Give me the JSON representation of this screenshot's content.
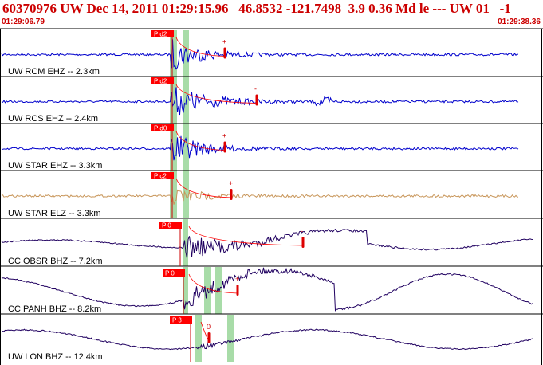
{
  "header": {
    "title": "60370976 UW Dec 14, 2011 01:29:15.96   46.8532 -121.7498  3.9 0.36 Md le --- UW 01   -1",
    "start_time": "01:29:06.79",
    "end_time": "01:29:38.36"
  },
  "colors": {
    "header_text": "#cc0000",
    "pick_box": "#ff0000",
    "pick_window": "#a8dca8",
    "trace_blue": "#0000cc",
    "trace_tan": "#c8965a",
    "trace_navy": "#200060",
    "coda_curve": "#ff0000"
  },
  "traces": [
    {
      "label": "UW RCM EHZ -- 2.3km",
      "pick_label": "P d2",
      "color": "#0000cc"
    },
    {
      "label": "UW RCS EHZ -- 2.4km",
      "pick_label": "P d2",
      "color": "#0000cc"
    },
    {
      "label": "UW STAR EHZ -- 3.3km",
      "pick_label": "P d0",
      "color": "#0000cc"
    },
    {
      "label": "UW STAR ELZ -- 3.3km",
      "pick_label": "P c2",
      "color": "#c8965a"
    },
    {
      "label": "CC OBSR BHZ -- 7.2km",
      "pick_label": "P 0",
      "color": "#200060"
    },
    {
      "label": "CC PANH BHZ -- 8.2km",
      "pick_label": "P 0",
      "color": "#200060"
    },
    {
      "label": "UW LON BHZ -- 12.4km",
      "pick_label": "P 3",
      "color": "#200060"
    }
  ],
  "pick_marks": [
    "+",
    "-",
    "+",
    "+",
    "-",
    "+",
    "0"
  ]
}
